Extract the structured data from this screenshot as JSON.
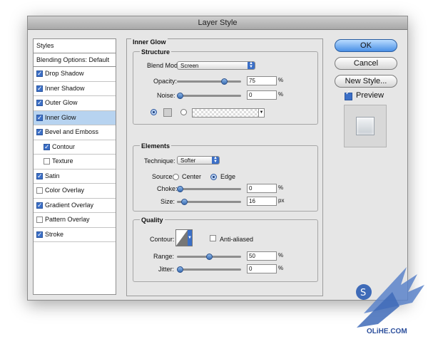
{
  "window": {
    "title": "Layer Style"
  },
  "styles_panel": {
    "header": "Styles",
    "blending_options": "Blending Options: Default",
    "items": [
      {
        "label": "Drop Shadow",
        "checked": true,
        "selected": false
      },
      {
        "label": "Inner Shadow",
        "checked": true,
        "selected": false
      },
      {
        "label": "Outer Glow",
        "checked": true,
        "selected": false
      },
      {
        "label": "Inner Glow",
        "checked": true,
        "selected": true
      },
      {
        "label": "Bevel and Emboss",
        "checked": true,
        "selected": false
      },
      {
        "label": "Contour",
        "checked": true,
        "selected": false,
        "indent": true
      },
      {
        "label": "Texture",
        "checked": false,
        "selected": false,
        "indent": true
      },
      {
        "label": "Satin",
        "checked": true,
        "selected": false
      },
      {
        "label": "Color Overlay",
        "checked": false,
        "selected": false
      },
      {
        "label": "Gradient Overlay",
        "checked": true,
        "selected": false
      },
      {
        "label": "Pattern Overlay",
        "checked": false,
        "selected": false
      },
      {
        "label": "Stroke",
        "checked": true,
        "selected": false
      }
    ]
  },
  "inner_glow": {
    "title": "Inner Glow",
    "structure": {
      "title": "Structure",
      "blend_mode_label": "Blend Mode:",
      "blend_mode_value": "Screen",
      "opacity_label": "Opacity:",
      "opacity_value": "75",
      "opacity_level": 0.75,
      "noise_label": "Noise:",
      "noise_value": "0",
      "noise_level": 0,
      "percent": "%"
    },
    "elements": {
      "title": "Elements",
      "technique_label": "Technique:",
      "technique_value": "Softer",
      "source_label": "Source:",
      "source_center": "Center",
      "source_edge": "Edge",
      "choke_label": "Choke:",
      "choke_value": "0",
      "choke_level": 0,
      "size_label": "Size:",
      "size_value": "16",
      "size_level": 0.07,
      "percent": "%",
      "px": "px"
    },
    "quality": {
      "title": "Quality",
      "contour_label": "Contour:",
      "anti_aliased_label": "Anti-aliased",
      "range_label": "Range:",
      "range_value": "50",
      "range_level": 0.5,
      "jitter_label": "Jitter:",
      "jitter_value": "0",
      "jitter_level": 0,
      "percent": "%"
    }
  },
  "buttons": {
    "ok": "OK",
    "cancel": "Cancel",
    "new_style": "New Style...",
    "preview": "Preview"
  },
  "watermark": {
    "text": "OLiHE.COM"
  }
}
